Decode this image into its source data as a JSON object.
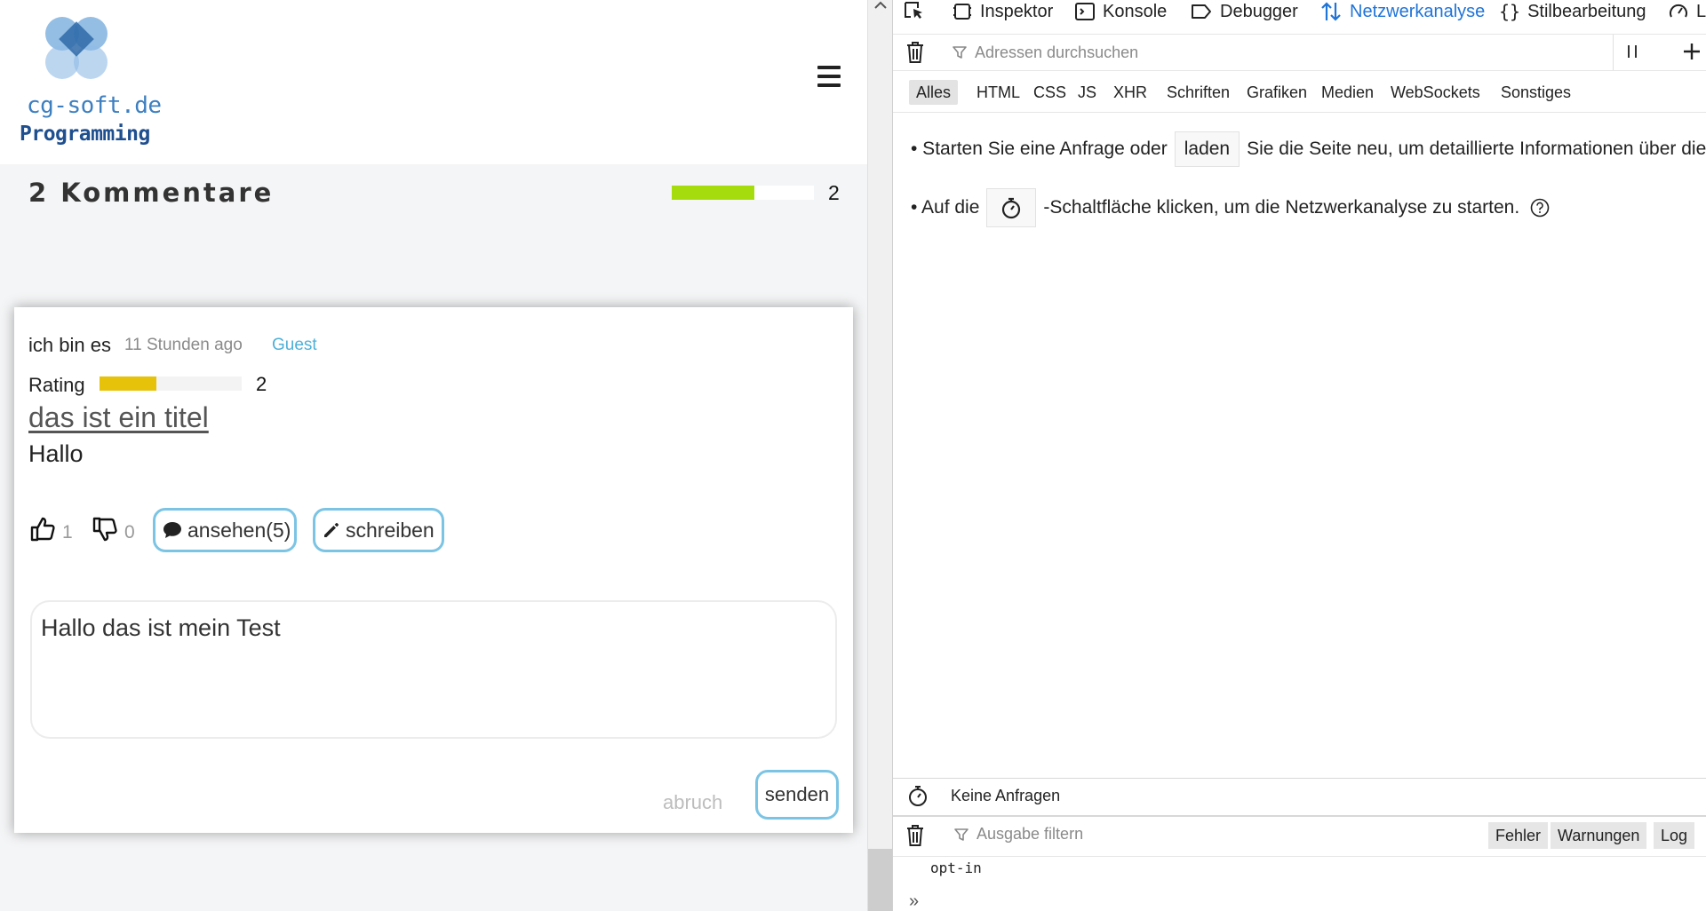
{
  "site": {
    "logo_line1": "cg-soft.de",
    "logo_line2": "Programming"
  },
  "comments": {
    "heading": "2 Kommentare",
    "overall_rating_fraction": 0.58,
    "overall_count": "2"
  },
  "comment": {
    "author": "ich bin es",
    "time": "11 Stunden ago",
    "role": "Guest",
    "rating_label": "Rating",
    "rating_fraction": 0.4,
    "rating_count": "2",
    "title": "das ist ein titel",
    "body": "Hallo",
    "likes": "1",
    "dislikes": "0",
    "view_label": "ansehen(5)",
    "write_label": "schreiben",
    "reply_value": "Hallo das ist mein Test",
    "abort_label": "abruch",
    "send_label": "senden"
  },
  "devtools": {
    "tabs": [
      {
        "label": "",
        "icon": "pick-element-icon"
      },
      {
        "label": "Inspektor",
        "icon": "inspector-icon"
      },
      {
        "label": "Konsole",
        "icon": "console-icon"
      },
      {
        "label": "Debugger",
        "icon": "debugger-icon"
      },
      {
        "label": "Netzwerkanalyse",
        "icon": "network-icon",
        "active": true
      },
      {
        "label": "Stilbearbeitung",
        "icon": "style-editor-icon"
      },
      {
        "label": "L",
        "icon": "performance-icon"
      }
    ],
    "url_filter_placeholder": "Adressen durchsuchen",
    "types": [
      "Alles",
      "HTML",
      "CSS",
      "JS",
      "XHR",
      "Schriften",
      "Grafiken",
      "Medien",
      "WebSockets",
      "Sonstiges"
    ],
    "hint1_pre": "• Starten Sie eine Anfrage oder",
    "hint1_button": "laden",
    "hint1_post": "Sie die Seite neu, um detaillierte Informationen über die",
    "hint2_pre": "• Auf die",
    "hint2_post": "-Schaltfläche klicken, um die Netzwerkanalyse zu starten.",
    "status": "Keine Anfragen",
    "console_filter_placeholder": "Ausgabe filtern",
    "levels": [
      "Fehler",
      "Warnungen",
      "Log"
    ],
    "console_message": "opt-in",
    "prompt": "»"
  },
  "colors": {
    "accent_blue": "#1f74d8",
    "pill_border": "#7cc4e4",
    "overall_bar": "#a5dc0e",
    "rating_bar": "#e6c20b",
    "guest_link": "#4fb0d8"
  }
}
